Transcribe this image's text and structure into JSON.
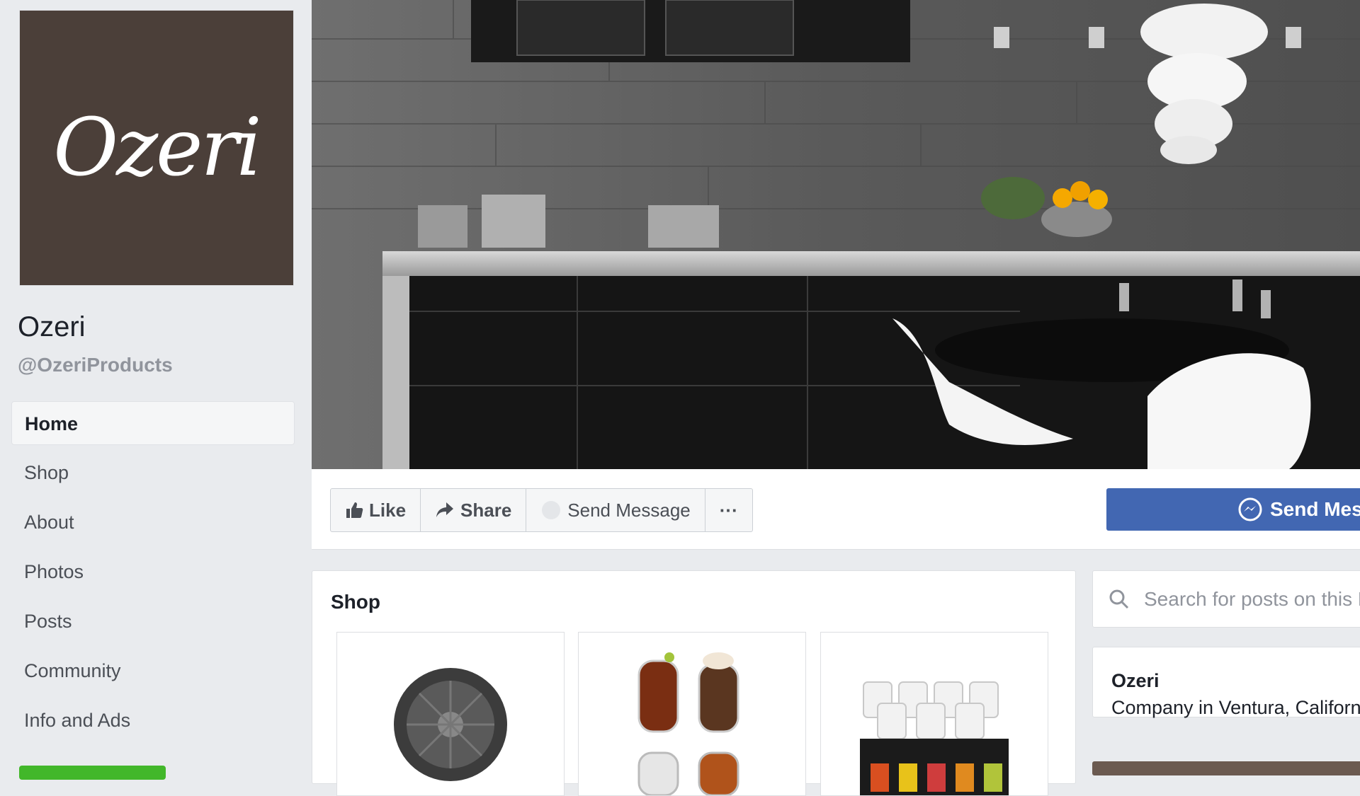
{
  "profile": {
    "logo_text": "Ozeri",
    "name": "Ozeri",
    "handle": "@OzeriProducts"
  },
  "sidebar": {
    "items": [
      {
        "label": "Home",
        "active": true
      },
      {
        "label": "Shop"
      },
      {
        "label": "About"
      },
      {
        "label": "Photos"
      },
      {
        "label": "Posts"
      },
      {
        "label": "Community"
      },
      {
        "label": "Info and Ads"
      }
    ]
  },
  "actions": {
    "like_label": "Like",
    "share_label": "Share",
    "send_message_label": "Send Message",
    "more_label": "···",
    "primary_send_label": "Send Message"
  },
  "shop": {
    "title": "Shop",
    "products": [
      {
        "icon": "fan-product-image"
      },
      {
        "icon": "glasses-product-image"
      },
      {
        "icon": "tumbler-set-product-image"
      }
    ]
  },
  "search": {
    "placeholder": "Search for posts on this Page"
  },
  "info": {
    "name": "Ozeri",
    "description": "Company in Ventura, California"
  },
  "colors": {
    "brand_blue": "#4267b2",
    "logo_background": "#4b3f39",
    "page_background": "#e9ebee",
    "green": "#42b72a"
  }
}
